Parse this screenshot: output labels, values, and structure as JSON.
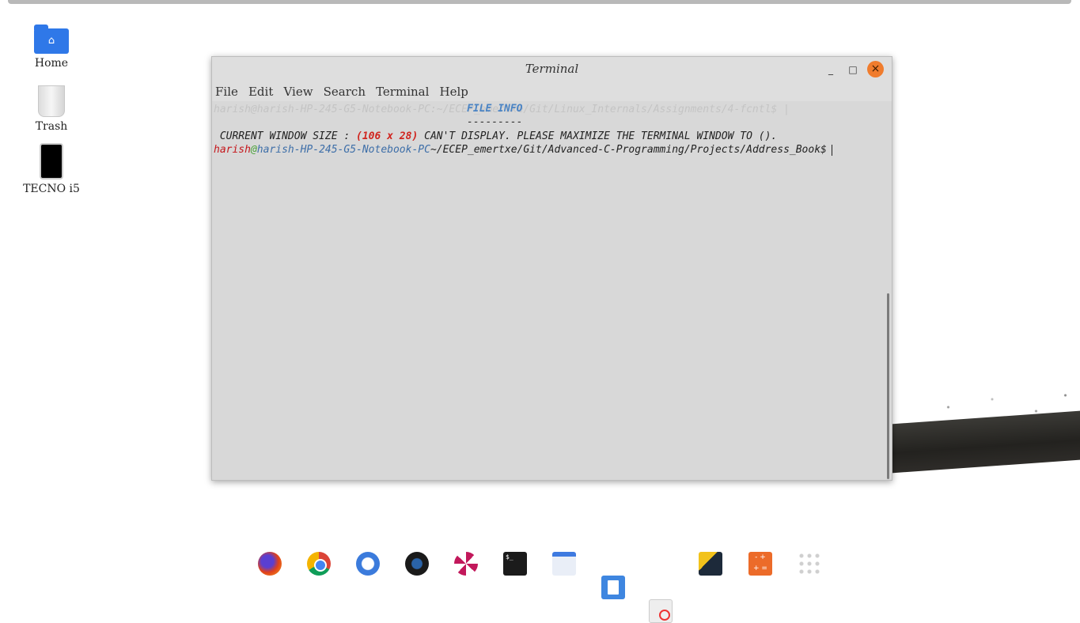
{
  "desktop": {
    "icons": [
      {
        "label": "Home",
        "icon": "home-folder-icon"
      },
      {
        "label": "Trash",
        "icon": "trash-icon"
      },
      {
        "label": "TECNO i5",
        "icon": "phone-icon"
      }
    ]
  },
  "window": {
    "title": "Terminal",
    "controls": {
      "minimize": "_",
      "maximize": "□",
      "close": "×"
    },
    "menu": [
      "File",
      "Edit",
      "View",
      "Search",
      "Terminal",
      "Help"
    ]
  },
  "terminal": {
    "ghost_line": "harish@harish-HP-245-G5-Notebook-PC:~/ECEP_emertxe/Git/Linux_Internals/Assignments/4-fcntl$ |",
    "info_title": "FILE INFO",
    "info_dashes": "---------",
    "size_prefix": " CURRENT WINDOW SIZE : ",
    "size_value": "(106 x 28)",
    "size_suffix": " CAN'T DISPLAY. PLEASE MAXIMIZE THE TERMINAL WINDOW TO ().",
    "prompt_user": "harish",
    "prompt_at": "@",
    "prompt_host": "harish-HP-245-G5-Notebook-PC",
    "prompt_path": "~/ECEP_emertxe/Git/Advanced-C-Programming/Projects/Address_Book$"
  },
  "dock": {
    "apps": [
      {
        "name": "firefox-icon"
      },
      {
        "name": "chrome-icon"
      },
      {
        "name": "mail-icon"
      },
      {
        "name": "steam-icon"
      },
      {
        "name": "pinwheel-icon"
      },
      {
        "name": "terminal-icon",
        "text": "$_"
      },
      {
        "name": "files-icon"
      },
      {
        "name": "document-viewer-icon"
      },
      {
        "name": "software-center-icon"
      },
      {
        "name": "play-store-icon"
      },
      {
        "name": "calculator-icon",
        "text": "- +\n+ ="
      },
      {
        "name": "app-grid-icon"
      }
    ]
  }
}
